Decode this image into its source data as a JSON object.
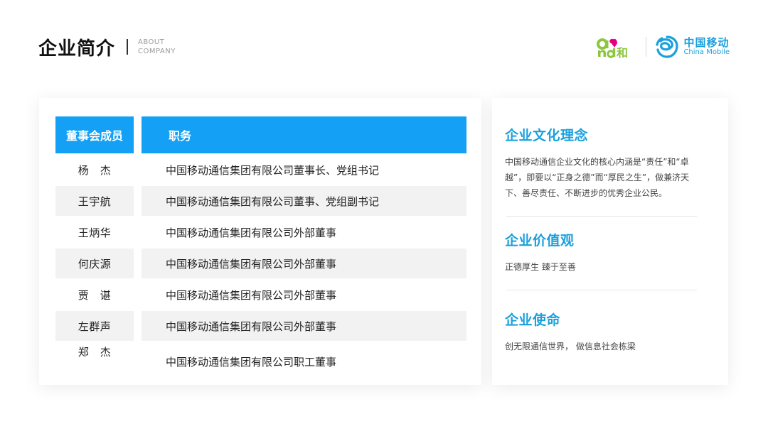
{
  "header": {
    "title": "企业简介",
    "subtitle_line1": "ABOUT",
    "subtitle_line2": "COMPANY"
  },
  "logos": {
    "and_logo_icon": "and-he-logo",
    "china_mobile_icon": "china-mobile-logo",
    "china_mobile_cn": "中国移动",
    "china_mobile_en": "China Mobile",
    "colors": {
      "and_green": "#8cc63f",
      "and_pink": "#e4007f",
      "cm_blue": "#1aa0dc"
    }
  },
  "table": {
    "header_name": "董事会成员",
    "header_role": "职务",
    "header_color": "#13a0f5",
    "rows": [
      {
        "name": "杨　杰",
        "role": "中国移动通信集团有限公司董事长、党组书记"
      },
      {
        "name": "王宇航",
        "role": "中国移动通信集团有限公司董事、党组副书记"
      },
      {
        "name": "王炳华",
        "role": "中国移动通信集团有限公司外部董事"
      },
      {
        "name": "何庆源",
        "role": "中国移动通信集团有限公司外部董事"
      },
      {
        "name": "贾　谌",
        "role": "中国移动通信集团有限公司外部董事"
      },
      {
        "name": "左群声",
        "role": "中国移动通信集团有限公司外部董事"
      },
      {
        "name": "郑　杰",
        "role": "中国移动通信集团有限公司职工董事"
      }
    ]
  },
  "sections": {
    "culture": {
      "title": "企业文化理念",
      "text": "中国移动通信企业文化的核心内涵是“责任”和“卓越”，即要以“正身之德”而“厚民之生”，做兼济天下、善尽责任、不断进步的优秀企业公民。"
    },
    "values": {
      "title": "企业价值观",
      "text": "正德厚生 臻于至善"
    },
    "mission": {
      "title": "企业使命",
      "text": "创无限通信世界，  做信息社会栋梁"
    }
  }
}
